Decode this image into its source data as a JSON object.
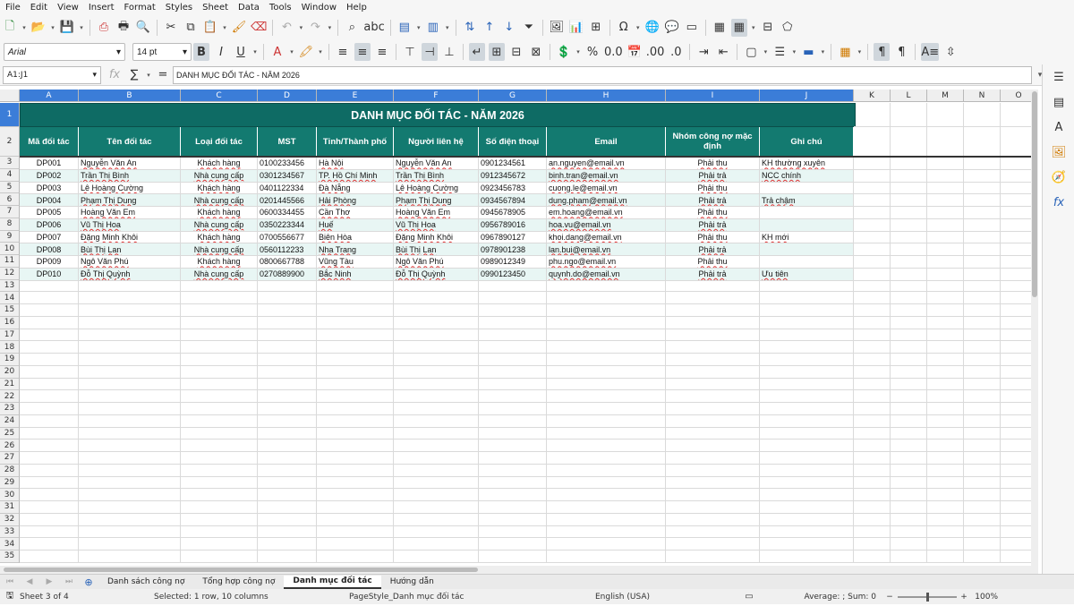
{
  "menu": [
    "File",
    "Edit",
    "View",
    "Insert",
    "Format",
    "Styles",
    "Sheet",
    "Data",
    "Tools",
    "Window",
    "Help"
  ],
  "font": {
    "name": "Arial",
    "size": "14 pt"
  },
  "namebox": "A1:J1",
  "formula_content": "DANH MỤC ĐỐI TÁC - NĂM 2026",
  "columns": [
    "A",
    "B",
    "C",
    "D",
    "E",
    "F",
    "G",
    "H",
    "I",
    "J",
    "K",
    "L",
    "M",
    "N",
    "O"
  ],
  "title": "DANH MỤC ĐỐI TÁC - NĂM 2026",
  "headers": [
    "Mã đối tác",
    "Tên đối tác",
    "Loại đối tác",
    "MST",
    "Tỉnh/Thành phố",
    "Người liên hệ",
    "Số điện thoại",
    "Email",
    "Nhóm công nợ mặc định",
    "Ghi chú"
  ],
  "rows": [
    [
      "DP001",
      "Nguyễn Văn An",
      "Khách hàng",
      "0100233456",
      "Hà Nội",
      "Nguyễn Văn An",
      "0901234561",
      "an.nguyen@email.vn",
      "Phải thu",
      "KH thường xuyên"
    ],
    [
      "DP002",
      "Trần Thị Bình",
      "Nhà cung cấp",
      "0301234567",
      "TP. Hồ Chí Minh",
      "Trần Thị Bình",
      "0912345672",
      "binh.tran@email.vn",
      "Phải trả",
      "NCC chính"
    ],
    [
      "DP003",
      "Lê Hoàng Cường",
      "Khách hàng",
      "0401122334",
      "Đà Nẵng",
      "Lê Hoàng Cường",
      "0923456783",
      "cuong.le@email.vn",
      "Phải thu",
      ""
    ],
    [
      "DP004",
      "Phạm Thị Dung",
      "Nhà cung cấp",
      "0201445566",
      "Hải Phòng",
      "Phạm Thị Dung",
      "0934567894",
      "dung.pham@email.vn",
      "Phải trả",
      "Trả chậm"
    ],
    [
      "DP005",
      "Hoàng Văn Em",
      "Khách hàng",
      "0600334455",
      "Cần Thơ",
      "Hoàng Văn Em",
      "0945678905",
      "em.hoang@email.vn",
      "Phải thu",
      ""
    ],
    [
      "DP006",
      "Vũ Thị Hoa",
      "Nhà cung cấp",
      "0350223344",
      "Huế",
      "Vũ Thị Hoa",
      "0956789016",
      "hoa.vu@email.vn",
      "Phải trả",
      ""
    ],
    [
      "DP007",
      "Đặng Minh Khôi",
      "Khách hàng",
      "0700556677",
      "Biên Hòa",
      "Đặng Minh Khôi",
      "0967890127",
      "khoi.dang@email.vn",
      "Phải thu",
      "KH mới"
    ],
    [
      "DP008",
      "Bùi Thị Lan",
      "Nhà cung cấp",
      "0560112233",
      "Nha Trang",
      "Bùi Thị Lan",
      "0978901238",
      "lan.bui@email.vn",
      "Phải trả",
      ""
    ],
    [
      "DP009",
      "Ngô Văn Phú",
      "Khách hàng",
      "0800667788",
      "Vũng Tàu",
      "Ngô Văn Phú",
      "0989012349",
      "phu.ngo@email.vn",
      "Phải thu",
      ""
    ],
    [
      "DP010",
      "Đỗ Thị Quỳnh",
      "Nhà cung cấp",
      "0270889900",
      "Bắc Ninh",
      "Đỗ Thị Quỳnh",
      "0990123450",
      "quynh.do@email.vn",
      "Phải trả",
      "Ưu tiên"
    ]
  ],
  "row_numbers": [
    "1",
    "2",
    "3",
    "4",
    "5",
    "6",
    "7",
    "8",
    "9",
    "10",
    "11",
    "12",
    "13",
    "14",
    "15",
    "16",
    "17",
    "18",
    "19",
    "20",
    "21",
    "22",
    "23",
    "24",
    "25",
    "26",
    "27",
    "28",
    "29",
    "30",
    "31",
    "32",
    "33",
    "34",
    "35"
  ],
  "tabs": [
    "Danh sách công nợ",
    "Tổng hợp công nợ",
    "Danh mục đối tác",
    "Hướng dẫn"
  ],
  "active_tab": 2,
  "status": {
    "sheet": "Sheet 3 of 4",
    "selection": "Selected: 1 row, 10 columns",
    "pagestyle": "PageStyle_Danh mục đối tác",
    "language": "English (USA)",
    "summary": "Average: ; Sum: 0",
    "zoom": "100%"
  },
  "colors": {
    "title_bg": "#0e6b64",
    "header_bg": "#137a70",
    "selection": "#3b7dd8",
    "alt_row": "#e8f6f4"
  }
}
